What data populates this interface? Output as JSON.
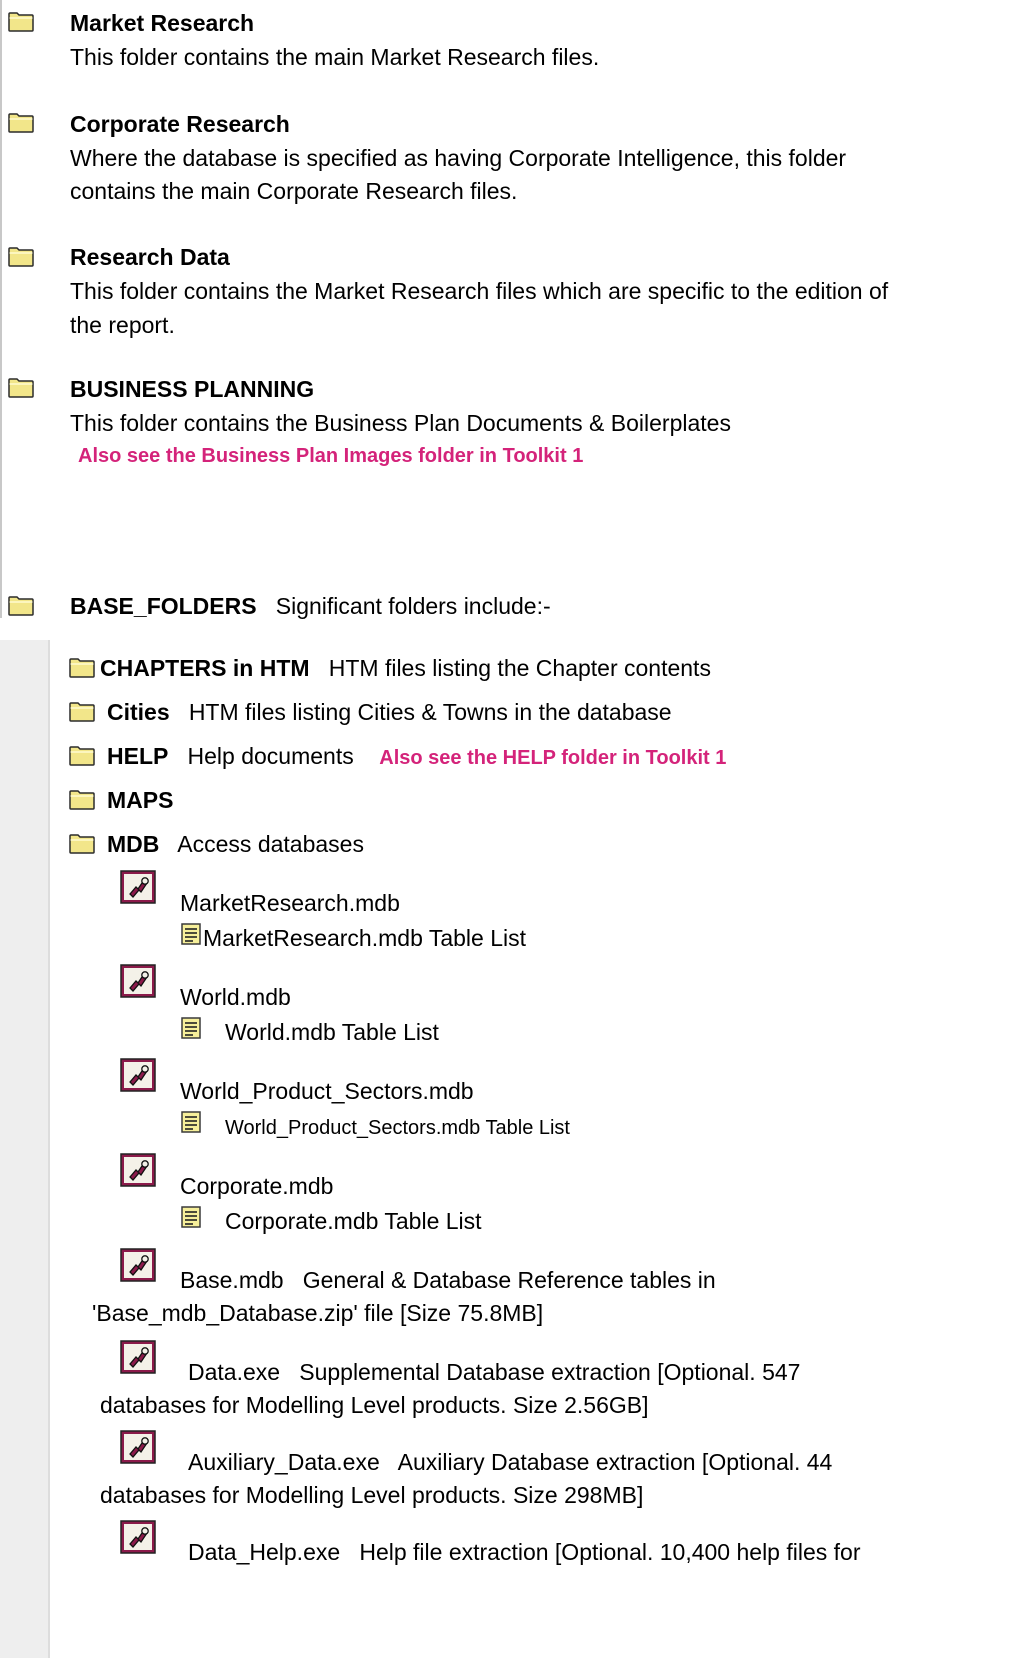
{
  "sections": [
    {
      "title": "Market Research",
      "desc": [
        "This folder contains the main Market Research files."
      ]
    },
    {
      "title": "Corporate Research",
      "desc": [
        "Where the database is specified as having Corporate Intelligence, this folder",
        "contains the main Corporate Research files."
      ]
    },
    {
      "title": "Research Data",
      "desc": [
        "This folder contains the Market Research files which are specific to the edition of",
        "the report."
      ]
    },
    {
      "title": "BUSINESS PLANNING",
      "desc": [
        "This folder contains the Business Plan Documents & Boilerplates"
      ],
      "note": "Also see the Business Plan Images folder in Toolkit 1"
    }
  ],
  "base": {
    "title": "BASE_FOLDERS",
    "desc": "Significant folders include:-"
  },
  "subfolders": [
    {
      "name": "CHAPTERS in HTM",
      "desc": "HTM files listing the Chapter contents"
    },
    {
      "name": "Cities",
      "desc": "HTM files listing Cities & Towns in the database"
    },
    {
      "name": "HELP",
      "desc": "Help documents",
      "note": "Also see the HELP folder in Toolkit 1"
    },
    {
      "name": "MAPS",
      "desc": ""
    },
    {
      "name": "MDB",
      "desc": "Access databases"
    }
  ],
  "databases": [
    {
      "name": "MarketResearch.mdb",
      "table_list": "MarketResearch.mdb Table List"
    },
    {
      "name": "World.mdb",
      "table_list": "World.mdb Table List"
    },
    {
      "name": "World_Product_Sectors.mdb",
      "table_list": "World_Product_Sectors.mdb Table List"
    },
    {
      "name": "Corporate.mdb",
      "table_list": "Corporate.mdb Table List"
    }
  ],
  "extras": [
    {
      "name": "Base.mdb",
      "desc": "General & Database Reference tables in",
      "desc2": "'Base_mdb_Database.zip' file [Size 75.8MB]"
    },
    {
      "name": "Data.exe",
      "desc": "Supplemental Database extraction [Optional. 547",
      "desc2": "databases for Modelling Level products. Size 2.56GB]"
    },
    {
      "name": "Auxiliary_Data.exe",
      "desc": "Auxiliary Database extraction [Optional. 44",
      "desc2": "databases for Modelling Level products. Size 298MB]"
    },
    {
      "name": "Data_Help.exe",
      "desc": "Help file extraction [Optional. 10,400 help files for"
    }
  ],
  "colors": {
    "accent": "#d4237a",
    "folder": "#f2e68a",
    "access": "#8b1a4a"
  },
  "icons": {
    "folder": "folder-icon",
    "access": "access-db-icon",
    "document": "document-icon"
  }
}
